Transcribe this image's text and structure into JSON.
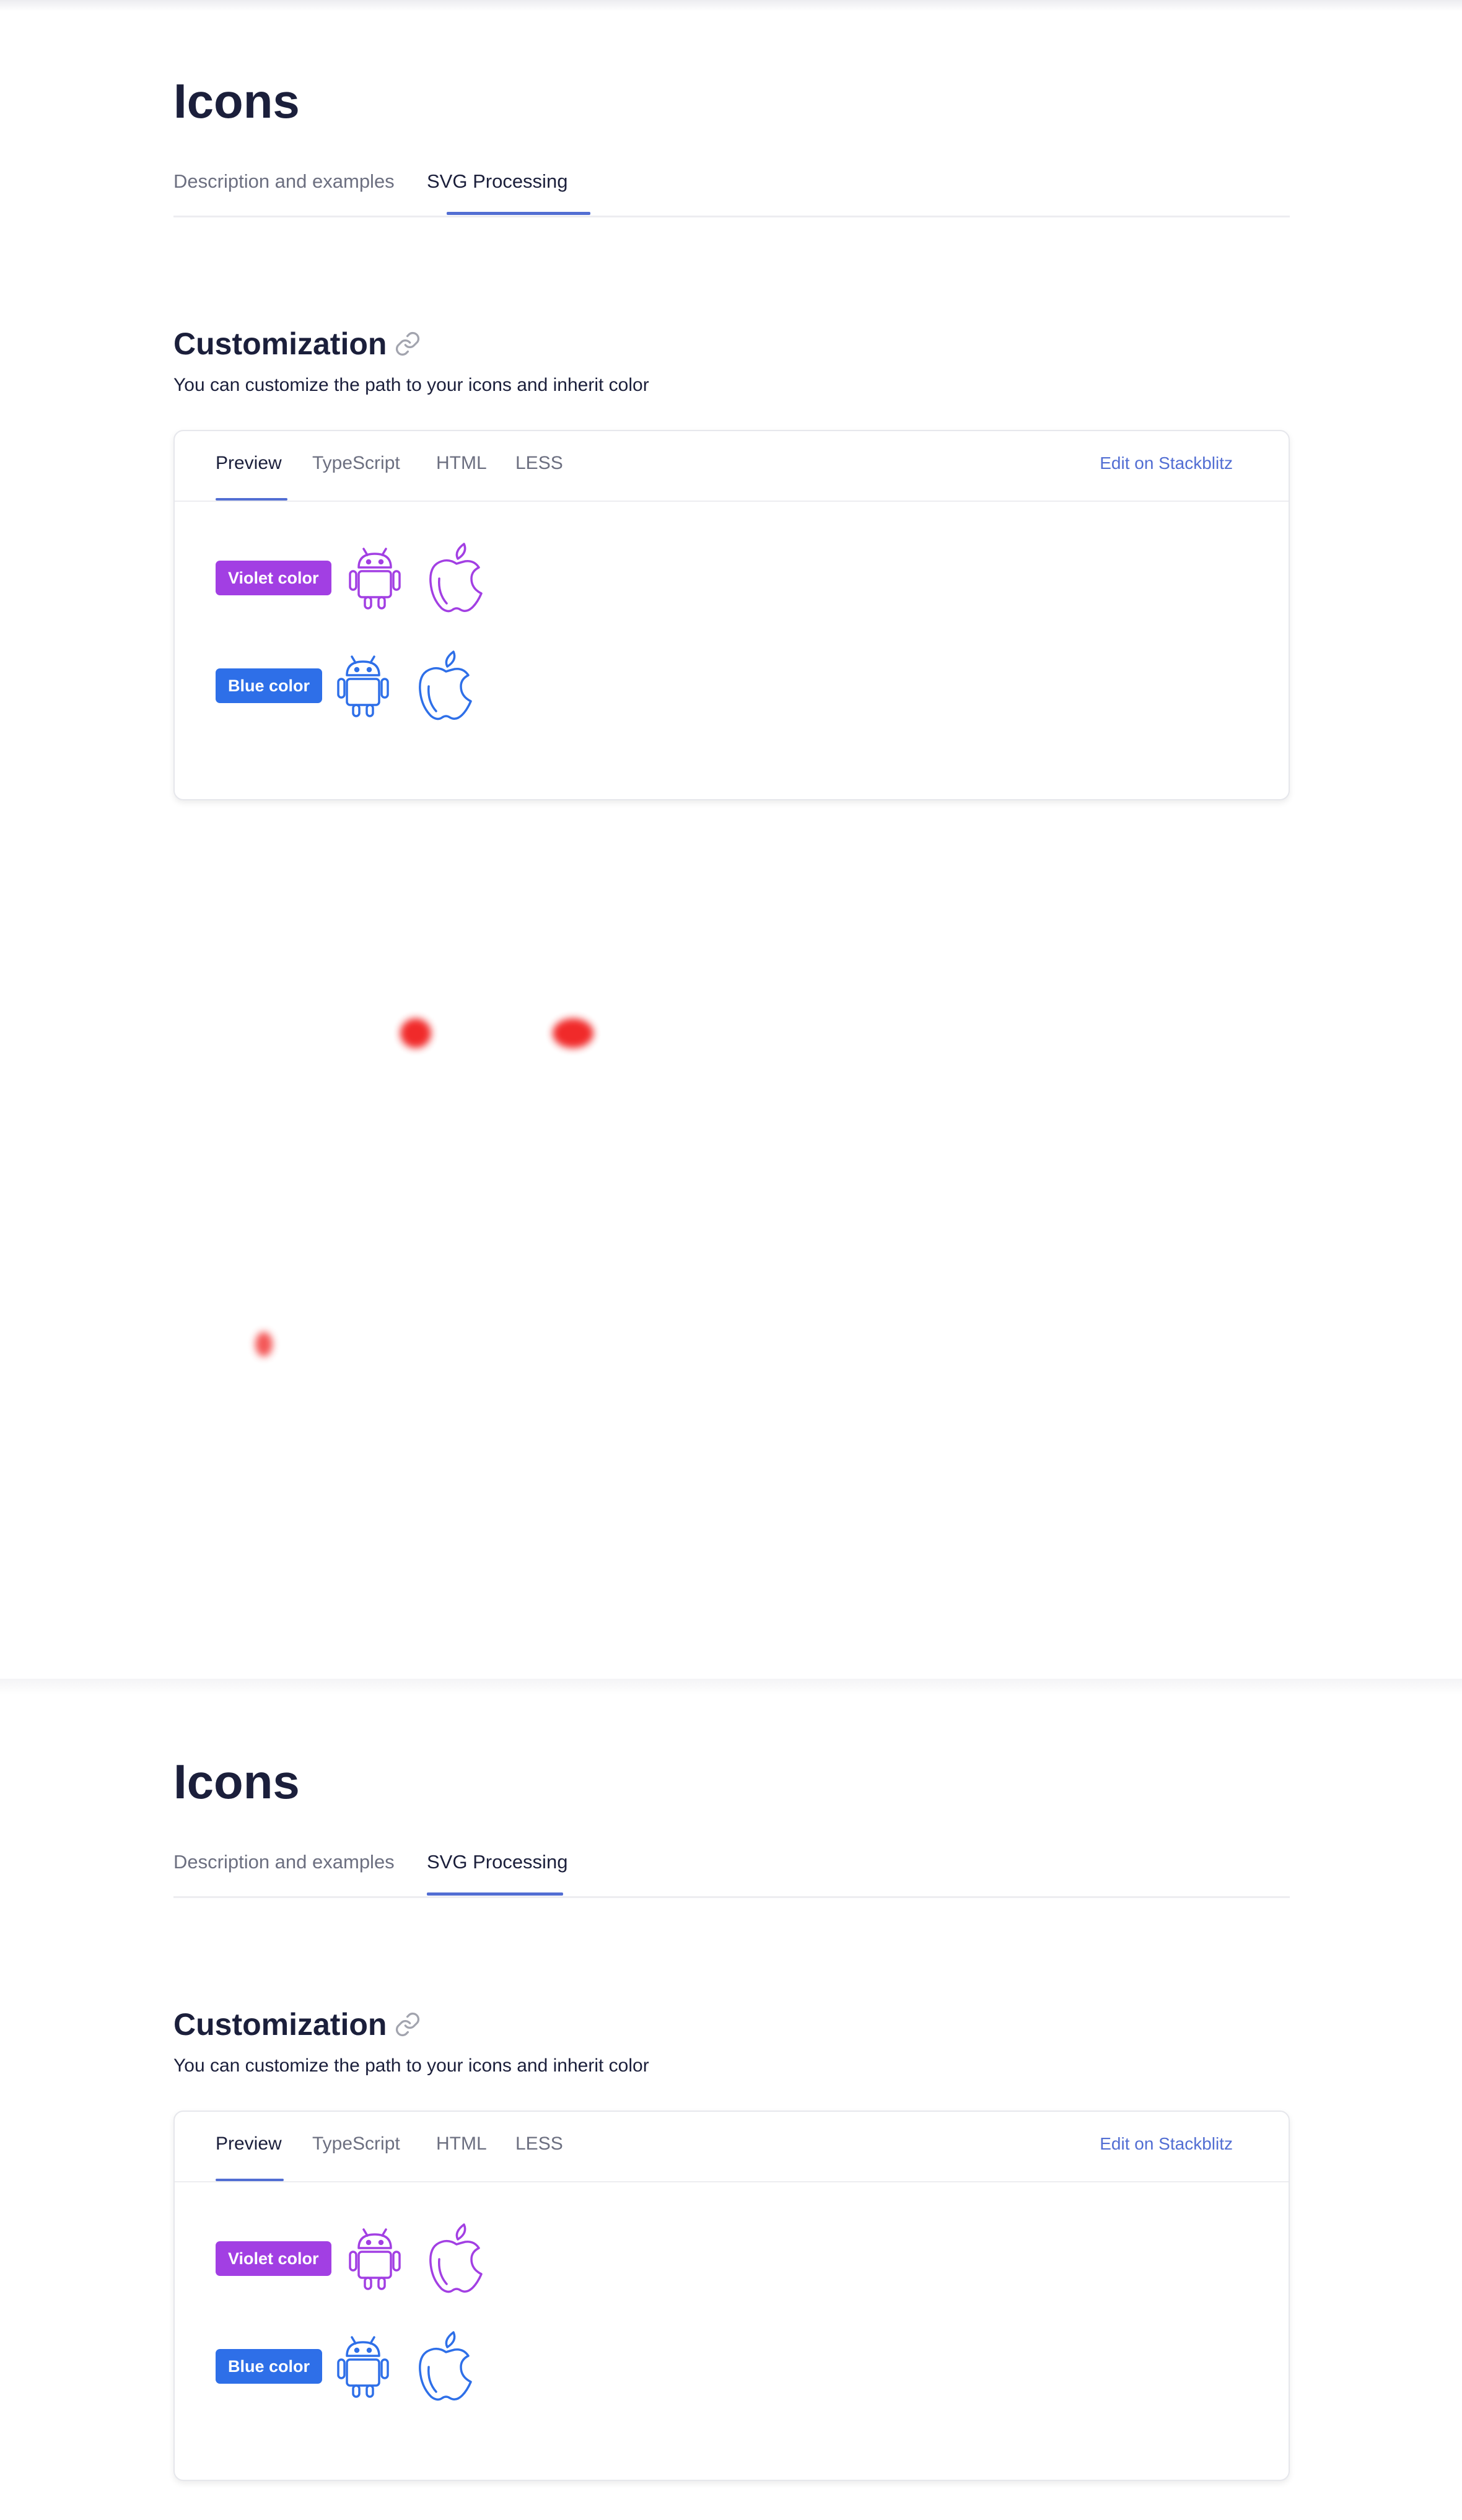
{
  "page": {
    "title": "Icons"
  },
  "page_tabs": [
    {
      "label": "Description and examples",
      "active": false
    },
    {
      "label": "SVG Processing",
      "active": true
    }
  ],
  "section": {
    "title": "Customization",
    "description": "You can customize the path to your icons and inherit color"
  },
  "card": {
    "tabs": [
      {
        "label": "Preview",
        "active": true
      },
      {
        "label": "TypeScript",
        "active": false
      },
      {
        "label": "HTML",
        "active": false
      },
      {
        "label": "LESS",
        "active": false
      }
    ],
    "edit_link": "Edit on Stackblitz",
    "rows": [
      {
        "badge": "Violet color",
        "color": "#a23fe3",
        "icons": [
          "android-icon",
          "apple-icon"
        ]
      },
      {
        "badge": "Blue color",
        "color": "#2e6fe8",
        "icons": [
          "android-icon",
          "apple-icon"
        ]
      }
    ]
  },
  "colors": {
    "accent": "#526ed3",
    "violet": "#a23fe3",
    "blue": "#2e6fe8",
    "text": "#1b1f3b",
    "muted": "#6c6f80"
  }
}
